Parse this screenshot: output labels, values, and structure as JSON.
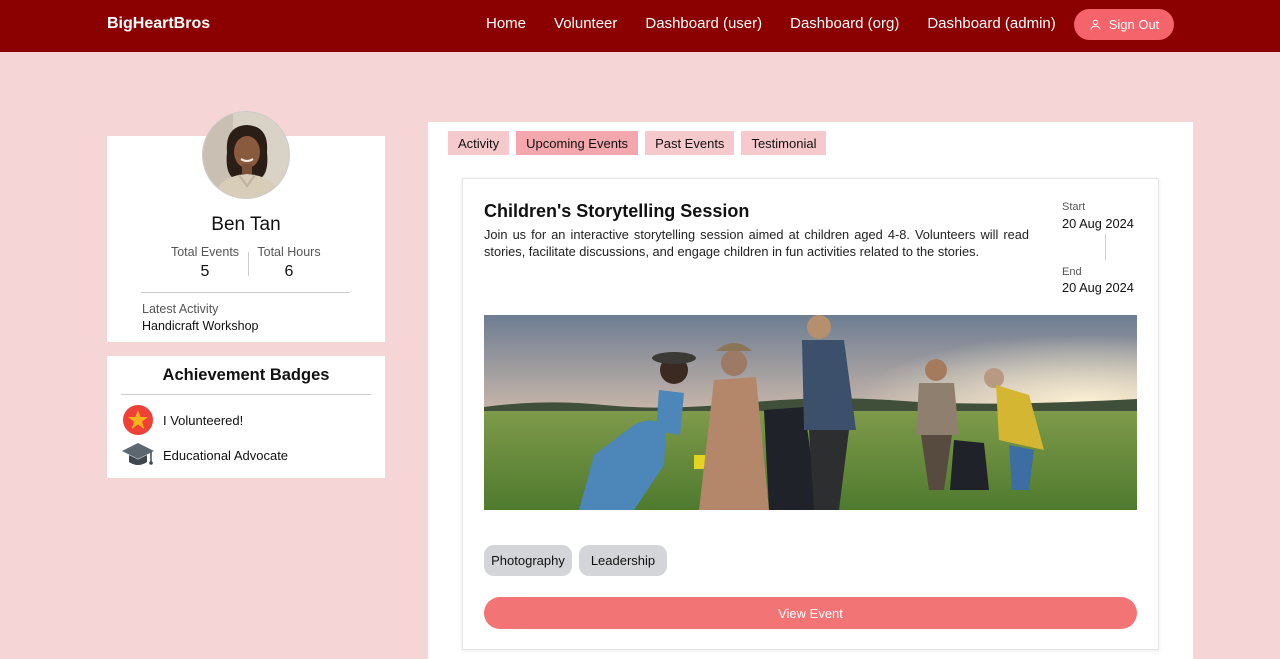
{
  "nav": {
    "brand": "BigHeartBros",
    "links": [
      "Home",
      "Volunteer",
      "Dashboard (user)",
      "Dashboard (org)",
      "Dashboard (admin)"
    ],
    "signout_label": "Sign Out",
    "signout_icon": "user-icon"
  },
  "profile": {
    "name": "Ben Tan",
    "total_events_label": "Total Events",
    "total_events": "5",
    "total_hours_label": "Total Hours",
    "total_hours": "6",
    "latest_activity_label": "Latest Activity",
    "latest_activity": "Handicraft Workshop"
  },
  "badges": {
    "title": "Achievement Badges",
    "items": [
      {
        "label": "I Volunteered!",
        "icon": "star-badge-icon"
      },
      {
        "label": "Educational Advocate",
        "icon": "graduation-cap-icon"
      }
    ]
  },
  "tabs": [
    {
      "label": "Activity",
      "active": false
    },
    {
      "label": "Upcoming Events",
      "active": true
    },
    {
      "label": "Past Events",
      "active": false
    },
    {
      "label": "Testimonial",
      "active": false
    }
  ],
  "event": {
    "title": "Children's Storytelling Session",
    "description": "Join us for an interactive storytelling session aimed at children aged 4-8. Volunteers will read stories, facilitate discussions, and engage children in fun activities related to the stories.",
    "start_label": "Start",
    "start_date": "20 Aug 2024",
    "end_label": "End",
    "end_date": "20 Aug 2024",
    "tags": [
      "Photography",
      "Leadership"
    ],
    "view_button": "View Event"
  },
  "colors": {
    "navbar": "#8b0000",
    "background": "#f6d5d7",
    "accent": "#f27474",
    "tab": "#f6c9cc",
    "tab_active": "#f4a8ad"
  }
}
